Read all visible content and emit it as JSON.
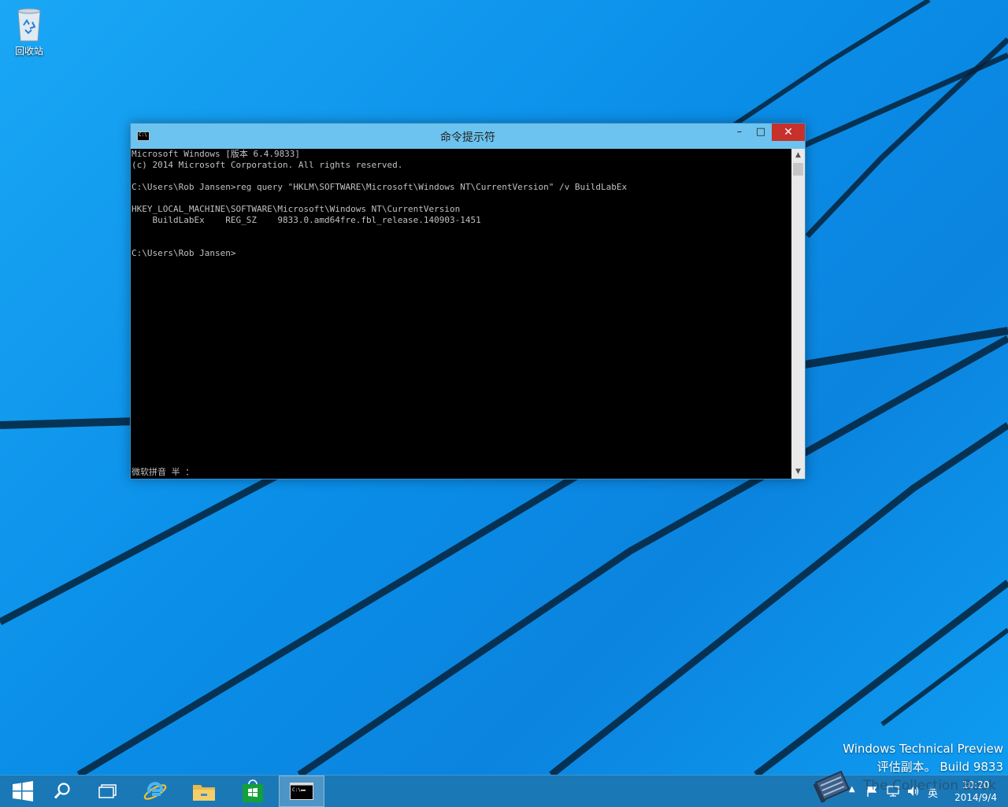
{
  "desktop": {
    "recycle_bin_label": "回收站"
  },
  "cmd_window": {
    "title": "命令提示符",
    "min_symbol": "–",
    "max_symbol": "□",
    "close_symbol": "✕",
    "console_lines": [
      "Microsoft Windows [版本 6.4.9833]",
      "(c) 2014 Microsoft Corporation. All rights reserved.",
      "",
      "C:\\Users\\Rob Jansen>reg query \"HKLM\\SOFTWARE\\Microsoft\\Windows NT\\CurrentVersion\" /v BuildLabEx",
      "",
      "HKEY_LOCAL_MACHINE\\SOFTWARE\\Microsoft\\Windows NT\\CurrentVersion",
      "    BuildLabEx    REG_SZ    9833.0.amd64fre.fbl_release.140903-1451",
      "",
      "",
      "C:\\Users\\Rob Jansen>"
    ],
    "ime_status": "微软拼音 半 ：",
    "icon_text": "C:\\"
  },
  "watermark": {
    "line1": "Windows Technical Preview",
    "line2": "评估副本。 Build 9833"
  },
  "taskbar": {
    "pinned": [
      "start-icon",
      "search-icon",
      "task-view-icon",
      "internet-explorer-icon",
      "file-explorer-icon",
      "store-icon",
      "command-prompt-icon"
    ],
    "tray": {
      "chevron": "▲",
      "language": "英"
    },
    "clock": {
      "time": "10:20",
      "date": "2014/9/4"
    }
  },
  "overlay": {
    "site_text": "The Collection Book"
  },
  "colors": {
    "wallpaper": "#0f8fe6",
    "titlebar": "#6cc3ef",
    "close_button": "#c7302b",
    "taskbar": "#1b78b6"
  }
}
